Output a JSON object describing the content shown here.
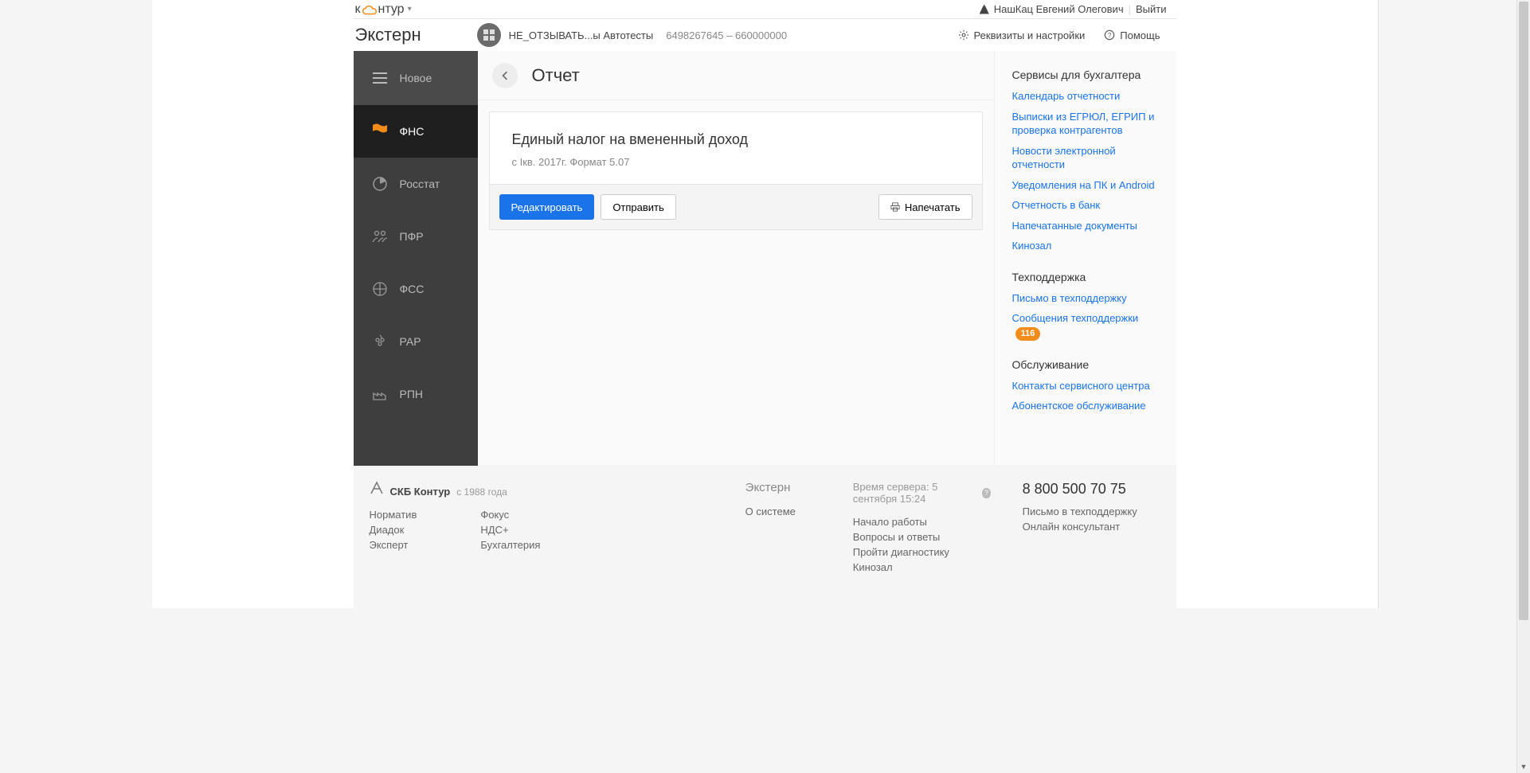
{
  "topbar": {
    "logo_left": "к",
    "logo_right": "нтур",
    "user_name": "НашКац Евгений Олегович",
    "logout": "Выйти"
  },
  "header": {
    "brand": "Экстерн",
    "org_name": "НЕ_ОТЗЫВАТЬ...ы Автотесты",
    "org_codes": "6498267645 – 660000000",
    "settings": "Реквизиты и настройки",
    "help": "Помощь"
  },
  "sidebar": {
    "items": [
      {
        "label": "Новое"
      },
      {
        "label": "ФНС"
      },
      {
        "label": "Росстат"
      },
      {
        "label": "ПФР"
      },
      {
        "label": "ФСС"
      },
      {
        "label": "РАР"
      },
      {
        "label": "РПН"
      }
    ]
  },
  "content": {
    "page_title": "Отчет",
    "report_title": "Единый налог на вмененный доход",
    "report_sub": "с Iкв. 2017г. Формат 5.07",
    "btn_edit": "Редактировать",
    "btn_send": "Отправить",
    "btn_print": "Напечатать"
  },
  "right": {
    "s1_title": "Сервисы для бухгалтера",
    "s1_links": [
      "Календарь отчетности",
      "Выписки из ЕГРЮЛ, ЕГРИП и проверка контрагентов",
      "Новости электронной отчетности",
      "Уведомления на ПК и Android",
      "Отчетность в банк",
      "Напечатанные документы",
      "Кинозал"
    ],
    "s2_title": "Техподдержка",
    "s2_link1": "Письмо в техподдержку",
    "s2_link2": "Сообщения техподдержки",
    "s2_badge": "116",
    "s3_title": "Обслуживание",
    "s3_links": [
      "Контакты сервисного центра",
      "Абонентское обслуживание"
    ]
  },
  "footer": {
    "company": "СКБ Контур",
    "since": "с 1988 года",
    "col1a": [
      "Норматив",
      "Диадок",
      "Эксперт"
    ],
    "col1b": [
      "Фокус",
      "НДС+",
      "Бухгалтерия"
    ],
    "col2_h": "Экстерн",
    "col2": [
      "О системе"
    ],
    "col3_time": "Время сервера: 5 сентября 15:24",
    "col3": [
      "Начало работы",
      "Вопросы и ответы",
      "Пройти диагностику",
      "Кинозал"
    ],
    "phone": "8 800 500 70 75",
    "col4": [
      "Письмо в техподдержку",
      "Онлайн консультант"
    ]
  }
}
